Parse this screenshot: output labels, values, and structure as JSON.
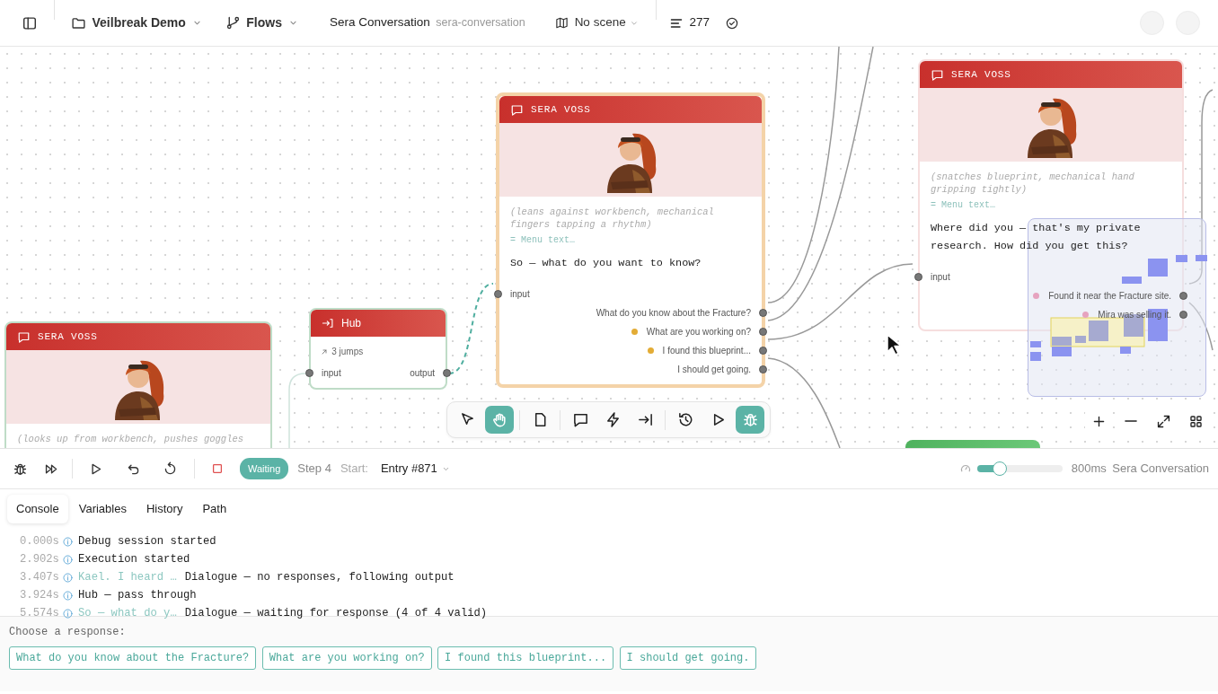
{
  "topbar": {
    "project": "Veilbreak Demo",
    "section": "Flows",
    "flow_title": "Sera Conversation",
    "flow_slug": "sera-conversation",
    "scene": "No scene",
    "count": "277"
  },
  "canvas": {
    "nodes": [
      {
        "kind": "dialogue",
        "current": false,
        "visited": true,
        "speaker": "SERA VOSS",
        "direction": "(looks up from workbench, pushes goggles"
      },
      {
        "kind": "hub",
        "current": false,
        "visited": true,
        "title": "Hub",
        "jumps": "3 jumps",
        "input": "input",
        "output": "output"
      },
      {
        "kind": "dialogue",
        "current": true,
        "visited": false,
        "speaker": "SERA VOSS",
        "direction": "(leans against workbench, mechanical fingers tapping a rhythm)",
        "menu_placeholder": "= Menu text…",
        "text": "So — what do you want to know?",
        "input": "input",
        "options": [
          {
            "label": "What do you know about the Fracture?"
          },
          {
            "label": "What are you working on?",
            "color": "#e3ac35"
          },
          {
            "label": "I found this blueprint...",
            "color": "#e3ac35"
          },
          {
            "label": "I should get going."
          }
        ]
      },
      {
        "kind": "dialogue",
        "current": false,
        "visited": false,
        "speaker": "SERA VOSS",
        "direction": "(snatches blueprint, mechanical hand gripping tightly)",
        "menu_placeholder": "= Menu text…",
        "text": "Where did you — that's my private research. How did you get this?",
        "input": "input",
        "options": [
          {
            "label": "Found it near the Fracture site.",
            "color": "#e6a3bf"
          },
          {
            "label": "Mira was selling it.",
            "color": "#e6a3bf"
          }
        ]
      },
      {
        "kind": "clipped"
      }
    ],
    "tools": [
      {
        "selected": false
      },
      {
        "selected": true
      },
      {
        "selected": false
      },
      {
        "selected": false
      },
      {
        "selected": false
      },
      {
        "selected": false
      },
      {
        "selected": false
      },
      {
        "selected": false
      },
      {
        "selected": true
      }
    ]
  },
  "debug": {
    "status": "Waiting",
    "step": "Step 4",
    "start_label": "Start:",
    "start_value": "Entry #871",
    "speed": {
      "level": 0.26,
      "reading": "800ms"
    },
    "flow": "Sera Conversation"
  },
  "tabs": [
    {
      "label": "Console",
      "selected": true
    },
    {
      "label": "Variables",
      "selected": false
    },
    {
      "label": "History",
      "selected": false
    },
    {
      "label": "Path",
      "selected": false
    }
  ],
  "console": [
    {
      "time": "0.000s",
      "message": "Debug session started"
    },
    {
      "time": "2.902s",
      "message": "Execution started"
    },
    {
      "time": "3.407s",
      "preview": "Kael. I heard …",
      "message": "Dialogue — no responses, following output"
    },
    {
      "time": "3.924s",
      "message": "Hub — pass through"
    },
    {
      "time": "5.574s",
      "preview": "So — what do y…",
      "message": "Dialogue — waiting for response (4 of 4 valid)"
    }
  ],
  "response": {
    "prompt": "Choose a response:",
    "options": [
      "What do you know about the Fracture?",
      "What are you working on?",
      "I found this blueprint...",
      "I should get going."
    ]
  }
}
